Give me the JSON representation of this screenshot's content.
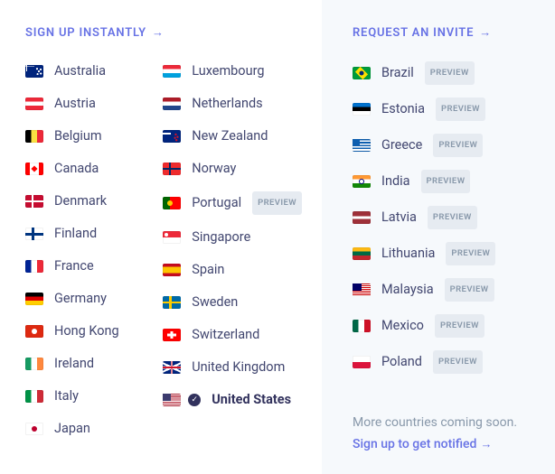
{
  "left": {
    "heading": "SIGN UP INSTANTLY",
    "col1": [
      {
        "code": "au",
        "name": "Australia"
      },
      {
        "code": "at",
        "name": "Austria"
      },
      {
        "code": "be",
        "name": "Belgium"
      },
      {
        "code": "ca",
        "name": "Canada"
      },
      {
        "code": "dk",
        "name": "Denmark"
      },
      {
        "code": "fi",
        "name": "Finland"
      },
      {
        "code": "fr",
        "name": "France"
      },
      {
        "code": "de",
        "name": "Germany"
      },
      {
        "code": "hk",
        "name": "Hong Kong"
      },
      {
        "code": "ie",
        "name": "Ireland"
      },
      {
        "code": "it",
        "name": "Italy"
      },
      {
        "code": "jp",
        "name": "Japan"
      }
    ],
    "col2": [
      {
        "code": "lu",
        "name": "Luxembourg"
      },
      {
        "code": "nl",
        "name": "Netherlands"
      },
      {
        "code": "nz",
        "name": "New Zealand"
      },
      {
        "code": "no",
        "name": "Norway"
      },
      {
        "code": "pt",
        "name": "Portugal",
        "preview": true
      },
      {
        "code": "sg",
        "name": "Singapore"
      },
      {
        "code": "es",
        "name": "Spain"
      },
      {
        "code": "se",
        "name": "Sweden"
      },
      {
        "code": "ch",
        "name": "Switzerland"
      },
      {
        "code": "gb",
        "name": "United Kingdom"
      },
      {
        "code": "us",
        "name": "United States",
        "selected": true
      }
    ]
  },
  "right": {
    "heading": "REQUEST AN INVITE",
    "list": [
      {
        "code": "br",
        "name": "Brazil",
        "preview": true
      },
      {
        "code": "ee",
        "name": "Estonia",
        "preview": true
      },
      {
        "code": "gr",
        "name": "Greece",
        "preview": true
      },
      {
        "code": "in",
        "name": "India",
        "preview": true
      },
      {
        "code": "lv",
        "name": "Latvia",
        "preview": true
      },
      {
        "code": "lt",
        "name": "Lithuania",
        "preview": true
      },
      {
        "code": "my",
        "name": "Malaysia",
        "preview": true
      },
      {
        "code": "mx",
        "name": "Mexico",
        "preview": true
      },
      {
        "code": "pl",
        "name": "Poland",
        "preview": true
      }
    ]
  },
  "footer": {
    "line1": "More countries coming soon.",
    "link": "Sign up to get notified"
  },
  "badge_label": "PREVIEW"
}
